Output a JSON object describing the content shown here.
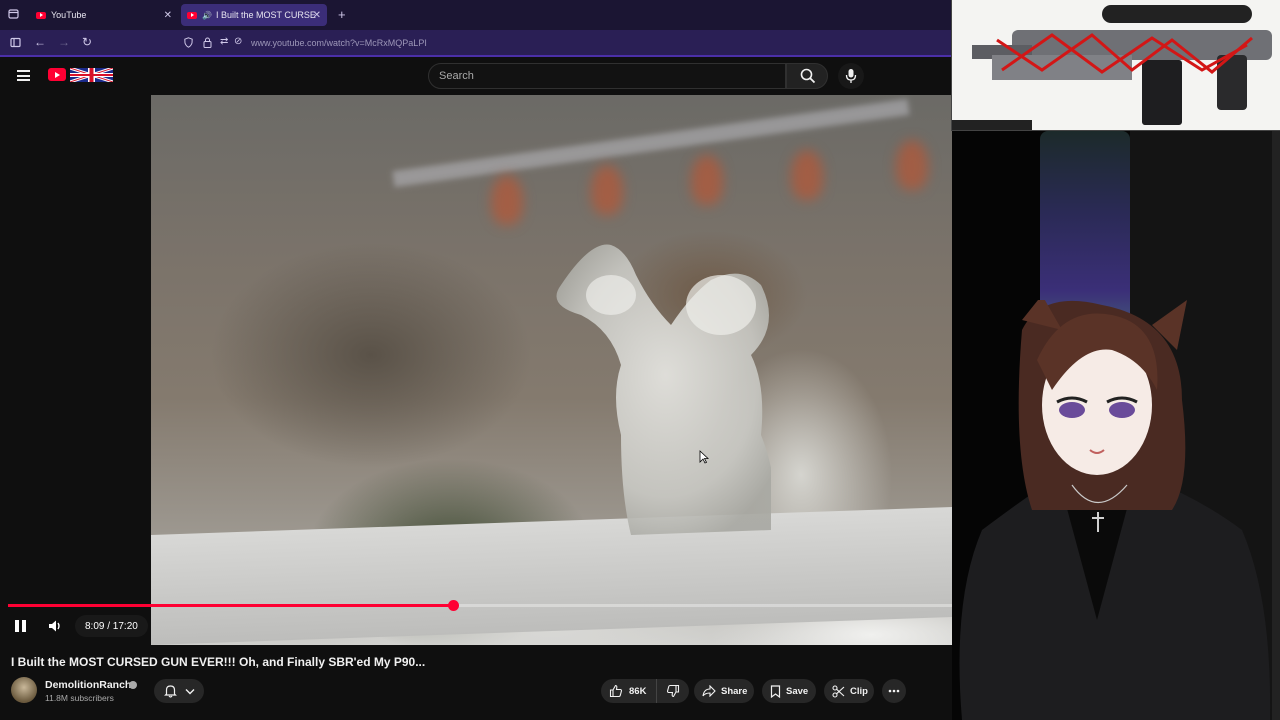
{
  "browser": {
    "tabs": [
      {
        "title": "YouTube",
        "active": false
      },
      {
        "title": "I Built the MOST CURSED G",
        "active": true
      }
    ],
    "url": "www.youtube.com/watch?v=McRxMQPaLPI"
  },
  "youtube": {
    "search_placeholder": "Search"
  },
  "player": {
    "current_time": "8:09",
    "duration": "17:20",
    "time_display": "8:09 / 17:20",
    "progress_fraction": 0.471,
    "playing": true
  },
  "video": {
    "title": "I Built the MOST CURSED GUN EVER!!! Oh, and Finally SBR'ed My P90...",
    "channel": "DemolitionRanch",
    "subscribers": "11.8M subscribers",
    "likes": "86K",
    "share_label": "Share",
    "save_label": "Save",
    "clip_label": "Clip"
  },
  "colors": {
    "accent": "#ff0033",
    "browser_tabbar": "#1b1533",
    "browser_navbar": "#2a1f55",
    "background": "#0f0f0f"
  }
}
